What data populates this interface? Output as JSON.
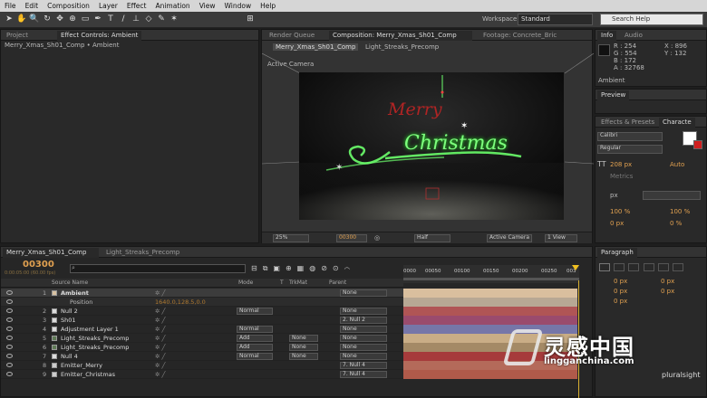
{
  "menu": [
    "File",
    "Edit",
    "Composition",
    "Layer",
    "Effect",
    "Animation",
    "View",
    "Window",
    "Help"
  ],
  "toolbar": {
    "workspace_label": "Workspace:",
    "workspace_value": "Standard",
    "search_placeholder": "Search Help"
  },
  "project_panel": {
    "tabs": [
      "Project",
      "Effect Controls: Ambient"
    ],
    "subtitle": "Merry_Xmas_Sh01_Comp • Ambient"
  },
  "comp_panel": {
    "tabs": [
      "Render Queue",
      "Composition: Merry_Xmas_Sh01_Comp",
      "Footage: Concrete_Bric"
    ],
    "subtabs": [
      "Merry_Xmas_Sh01_Comp",
      "Light_Streaks_Precomp"
    ],
    "view_label": "Active Camera",
    "footer": {
      "zoom": "25%",
      "timecode": "00300",
      "resolution": "Half",
      "view": "Active Camera",
      "views_count": "1 View"
    },
    "title_text": "Merry",
    "title_text2": "Christmas"
  },
  "info_panel": {
    "tabs": [
      "Info",
      "Audio"
    ],
    "r": "R : 254",
    "g": "G : 554",
    "b": "B : 172",
    "a": "A : 32768",
    "x": "X : 896",
    "y": "Y : 132",
    "layer": "Ambient"
  },
  "preview_panel": {
    "tab": "Preview"
  },
  "character_panel": {
    "tabs": [
      "Effects & Presets",
      "Characte"
    ],
    "font": "Calibri",
    "style": "Regular",
    "size": "208 px",
    "leading": "Auto",
    "tracking": "Metrics",
    "stroke": "px",
    "scale_v": "100 %",
    "scale_h": "100 %",
    "baseline": "0 px",
    "tsume": "0 %"
  },
  "paragraph_panel": {
    "tab": "Paragraph",
    "indent": [
      "0 px",
      "0 px",
      "0 px",
      "0 px",
      "0 px"
    ]
  },
  "timeline": {
    "tabs": [
      "Merry_Xmas_Sh01_Comp",
      "Light_Streaks_Precomp"
    ],
    "timecode": "00300",
    "fps": "0:00:05:00 (60.00 fps)",
    "columns": {
      "source": "Source Name",
      "mode": "Mode",
      "t": "T",
      "trkmat": "TrkMat",
      "parent": "Parent"
    },
    "ruler": [
      "0000",
      "00050",
      "00100",
      "00150",
      "00200",
      "00250",
      "003"
    ],
    "layers": [
      {
        "num": "1",
        "name": "Ambient",
        "color": "#d8c2a2",
        "mode": "",
        "trk": "",
        "parent": "None",
        "bar": "#d9bf9e",
        "selected": true
      },
      {
        "num": "",
        "name": "Position",
        "color": "",
        "mode": "",
        "trk": "",
        "parent": "",
        "bar": "#b7a894",
        "prop": "1640.0,128.5,0.0"
      },
      {
        "num": "2",
        "name": "Null 2",
        "color": "#dcdcdc",
        "mode": "Normal",
        "trk": "",
        "parent": "None",
        "bar": "#b05555"
      },
      {
        "num": "3",
        "name": "Sh01",
        "color": "#dcdcdc",
        "mode": "",
        "trk": "",
        "parent": "2. Null 2",
        "bar": "#9a4b6d"
      },
      {
        "num": "4",
        "name": "Adjustment Layer 1",
        "color": "#dcdcdc",
        "mode": "Normal",
        "trk": "",
        "parent": "None",
        "bar": "#7676a8"
      },
      {
        "num": "5",
        "name": "Light_Streaks_Precomp",
        "color": "#5f7a56",
        "mode": "Add",
        "trk": "None",
        "parent": "None",
        "bar": "#c9ad86"
      },
      {
        "num": "6",
        "name": "Light_Streaks_Precomp",
        "color": "#5f7a56",
        "mode": "Add",
        "trk": "None",
        "parent": "None",
        "bar": "#a48a66"
      },
      {
        "num": "7",
        "name": "Null 4",
        "color": "#dcdcdc",
        "mode": "Normal",
        "trk": "None",
        "parent": "None",
        "bar": "#a63b3b"
      },
      {
        "num": "8",
        "name": "Emitter_Merry",
        "color": "#cccccc",
        "mode": "",
        "trk": "",
        "parent": "7. Null 4",
        "bar": "#b46a5a"
      },
      {
        "num": "9",
        "name": "Emitter_Christmas",
        "color": "#cccccc",
        "mode": "",
        "trk": "",
        "parent": "7. Null 4",
        "bar": "#b05a4a"
      }
    ]
  },
  "watermark": {
    "brand": "灵感中国",
    "url": "lingganchina.com",
    "pluralsight": "pluralsight"
  }
}
